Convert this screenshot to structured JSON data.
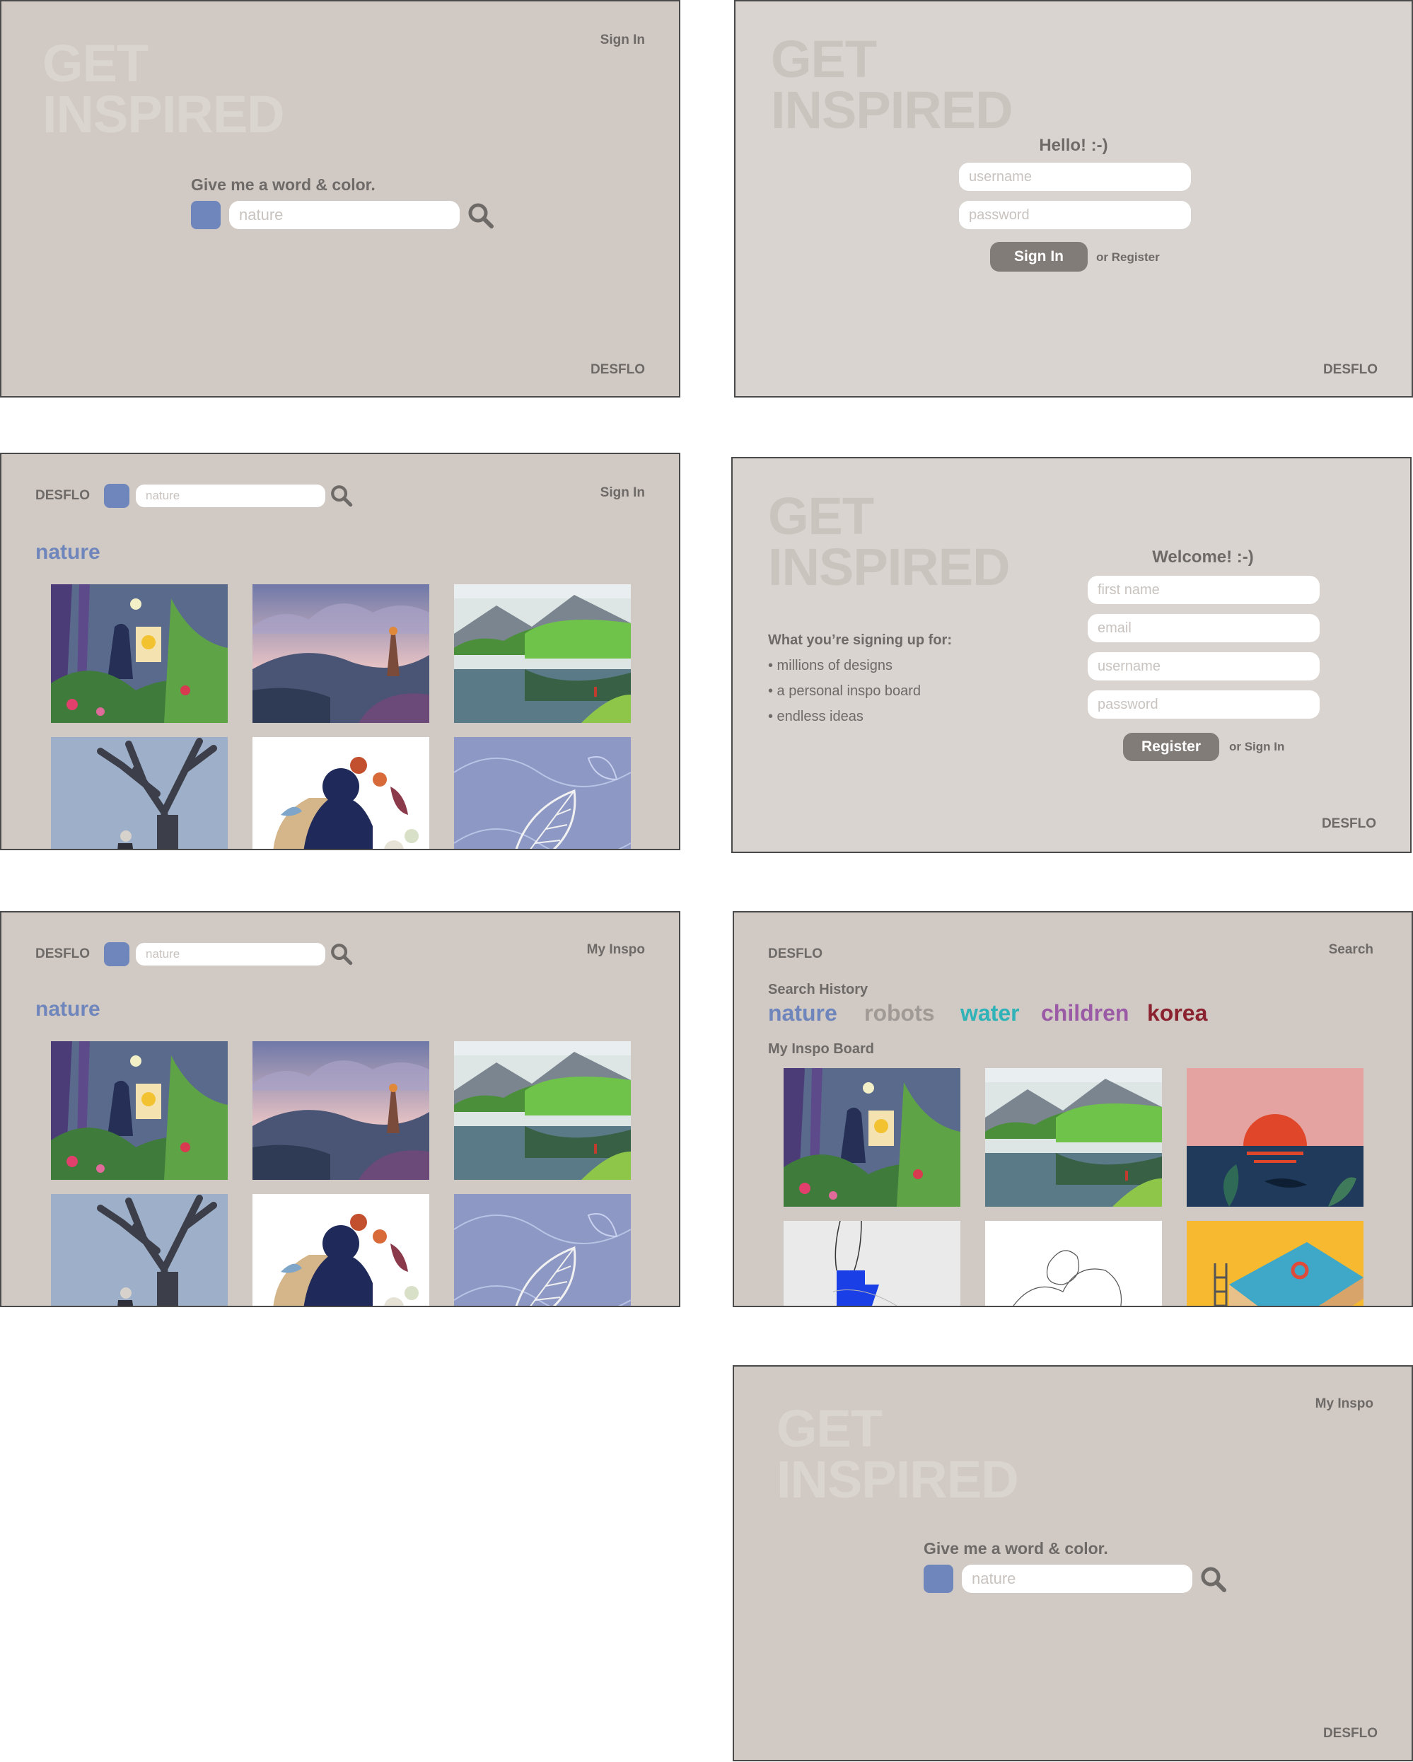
{
  "brand": "DESFLO",
  "hero": {
    "line1": "GET",
    "line2": "INSPIRED"
  },
  "search": {
    "prompt": "Give me a word & color.",
    "placeholder": "nature",
    "color": "#6f86bd"
  },
  "screen1": {
    "nav": "Sign In"
  },
  "signin": {
    "title": "Hello! :-)",
    "username_placeholder": "username",
    "password_placeholder": "password",
    "button": "Sign In",
    "alt_link": "or Register"
  },
  "results": {
    "nav_signed_out": "Sign In",
    "nav_signed_in": "My Inspo",
    "heading": "nature"
  },
  "register": {
    "title": "Welcome! :-)",
    "benefits_title": "What you’re signing up for:",
    "benefits": [
      "• millions of designs",
      "• a personal inspo board",
      "• endless ideas"
    ],
    "first_name_placeholder": "first name",
    "email_placeholder": "email",
    "username_placeholder": "username",
    "password_placeholder": "password",
    "button": "Register",
    "alt_link": "or Sign In"
  },
  "profile": {
    "nav": "Search",
    "history_title": "Search History",
    "history": [
      {
        "word": "nature",
        "color": "#6f86bd"
      },
      {
        "word": "robots",
        "color": "#a09a96"
      },
      {
        "word": "water",
        "color": "#2fb3b8"
      },
      {
        "word": "children",
        "color": "#9a5aa6"
      },
      {
        "word": "korea",
        "color": "#8b2230"
      }
    ],
    "board_title": "My Inspo Board"
  },
  "home_signed_in": {
    "nav": "My Inspo"
  },
  "colors": {
    "background": "#d1c9c3",
    "text": "#6e6a68",
    "accent": "#6f86bd",
    "button": "#827c78"
  }
}
